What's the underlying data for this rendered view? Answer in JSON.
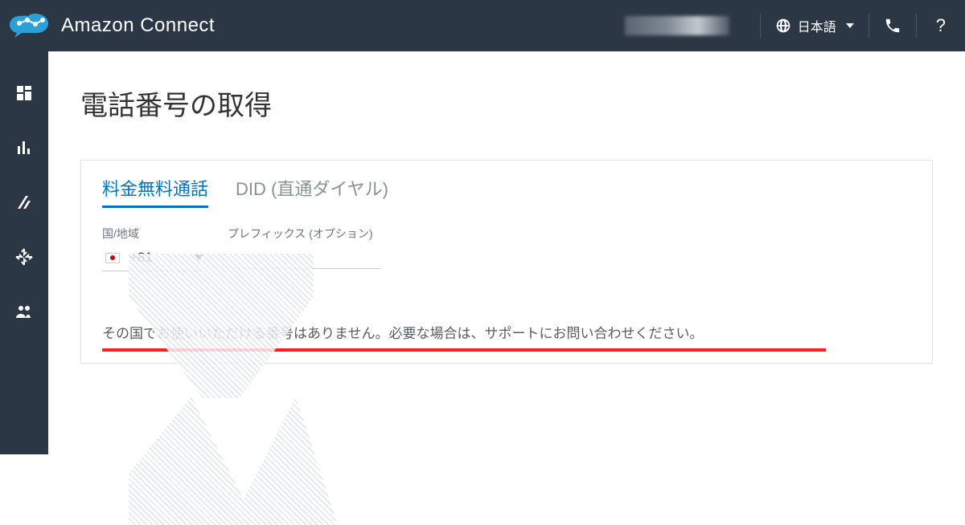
{
  "header": {
    "brand": "Amazon Connect",
    "language_label": "日本語"
  },
  "page": {
    "title": "電話番号の取得"
  },
  "tabs": {
    "toll_free": "料金無料通話",
    "did": "DID (直通ダイヤル)"
  },
  "fields": {
    "country_label": "国/地域",
    "dial_code": "+81",
    "prefix_label": "プレフィックス (オプション)"
  },
  "notice": {
    "message": "その国でお使いいただける番号はありません。必要な場合は、サポートにお問い合わせください。"
  }
}
